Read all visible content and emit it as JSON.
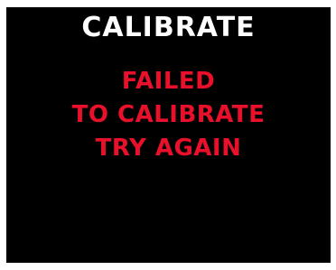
{
  "screen": {
    "title": "CALIBRATE",
    "title_color": "#ffffff",
    "background_color": "#000000",
    "message_color": "#e8102a",
    "message_lines": [
      "FAILED",
      "TO CALIBRATE",
      "TRY AGAIN"
    ]
  }
}
